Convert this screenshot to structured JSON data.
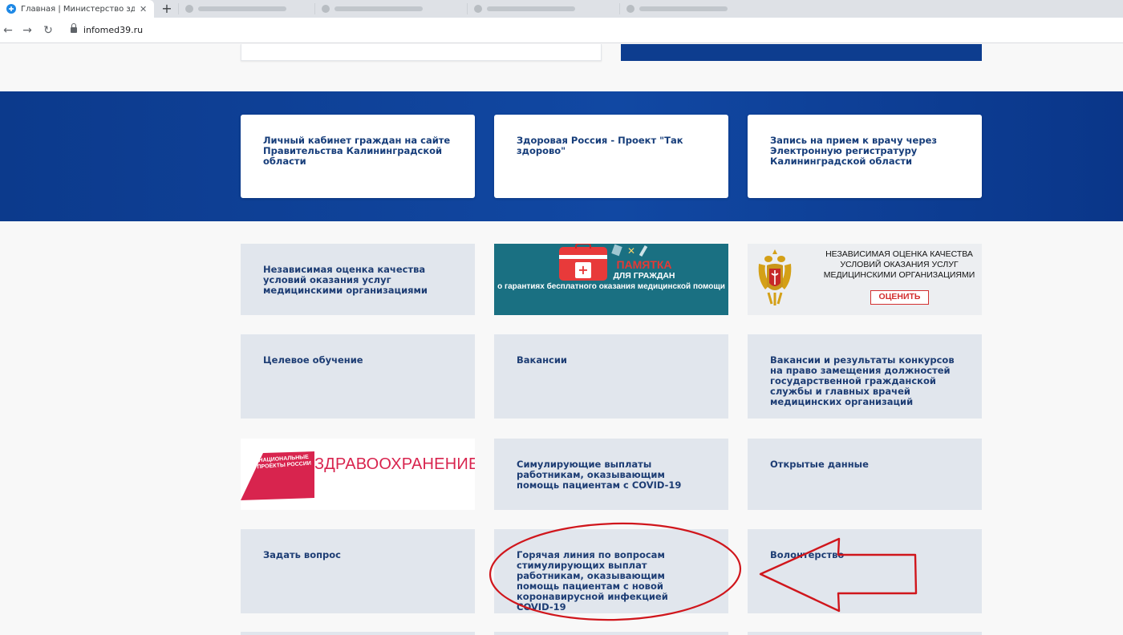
{
  "browser": {
    "active_tab_title": "Главная | Министерство здравс",
    "url": "infomed39.ru",
    "new_tab_label": "+",
    "close_label": "✕"
  },
  "hero_cards": [
    {
      "label": "Личный кабинет граждан на сайте Правительства Калининградской области"
    },
    {
      "label": "Здоровая Россия - Проект \"Так здорово\""
    },
    {
      "label": "Запись на прием к врачу через Электронную регистратуру Калининградской области"
    }
  ],
  "cards": {
    "nok_text": "Независимая оценка качества условий оказания услуг медицинскими организациями",
    "target_training": "Целевое обучение",
    "vacancies": "Вакансии",
    "vacancies_competitions": "Вакансии и результаты конкурсов на право замещения должностей государственной гражданской службы и главных врачей медицинских организаций",
    "stimulus_payments": "Симулирующие выплаты работникам, оказывающим помощь пациентам с COVID-19",
    "open_data": "Открытые данные",
    "ask_question": "Задать вопрос",
    "hotline": "Горячая линия по вопросам стимулирующих выплат работникам, оказывающим помощь пациентам с новой коронавирусной инфекцией COVID-19",
    "volunteering": "Волонтерство"
  },
  "memo_banner": {
    "line1": "ПАМЯТКА",
    "line2": "ДЛЯ ГРАЖДАН",
    "line3": "о гарантиях бесплатного оказания медицинской помощи"
  },
  "nok_banner": {
    "title": "НЕЗАВИСИМАЯ ОЦЕНКА КАЧЕСТВА УСЛОВИЙ ОКАЗАНИЯ УСЛУГ МЕДИЦИНСКИМИ ОРГАНИЗАЦИЯМИ",
    "button": "ОЦЕНИТЬ"
  },
  "np_banner": {
    "small": "НАЦИОНАЛЬНЫЕ ПРОЕКТЫ РОССИИ",
    "big": "ЗДРАВООХРАНЕНИЕ"
  },
  "colors": {
    "band": "#0c3a8c",
    "card_bg": "#e1e6ed",
    "card_text": "#1d3d74",
    "annotation": "#d0161c"
  }
}
